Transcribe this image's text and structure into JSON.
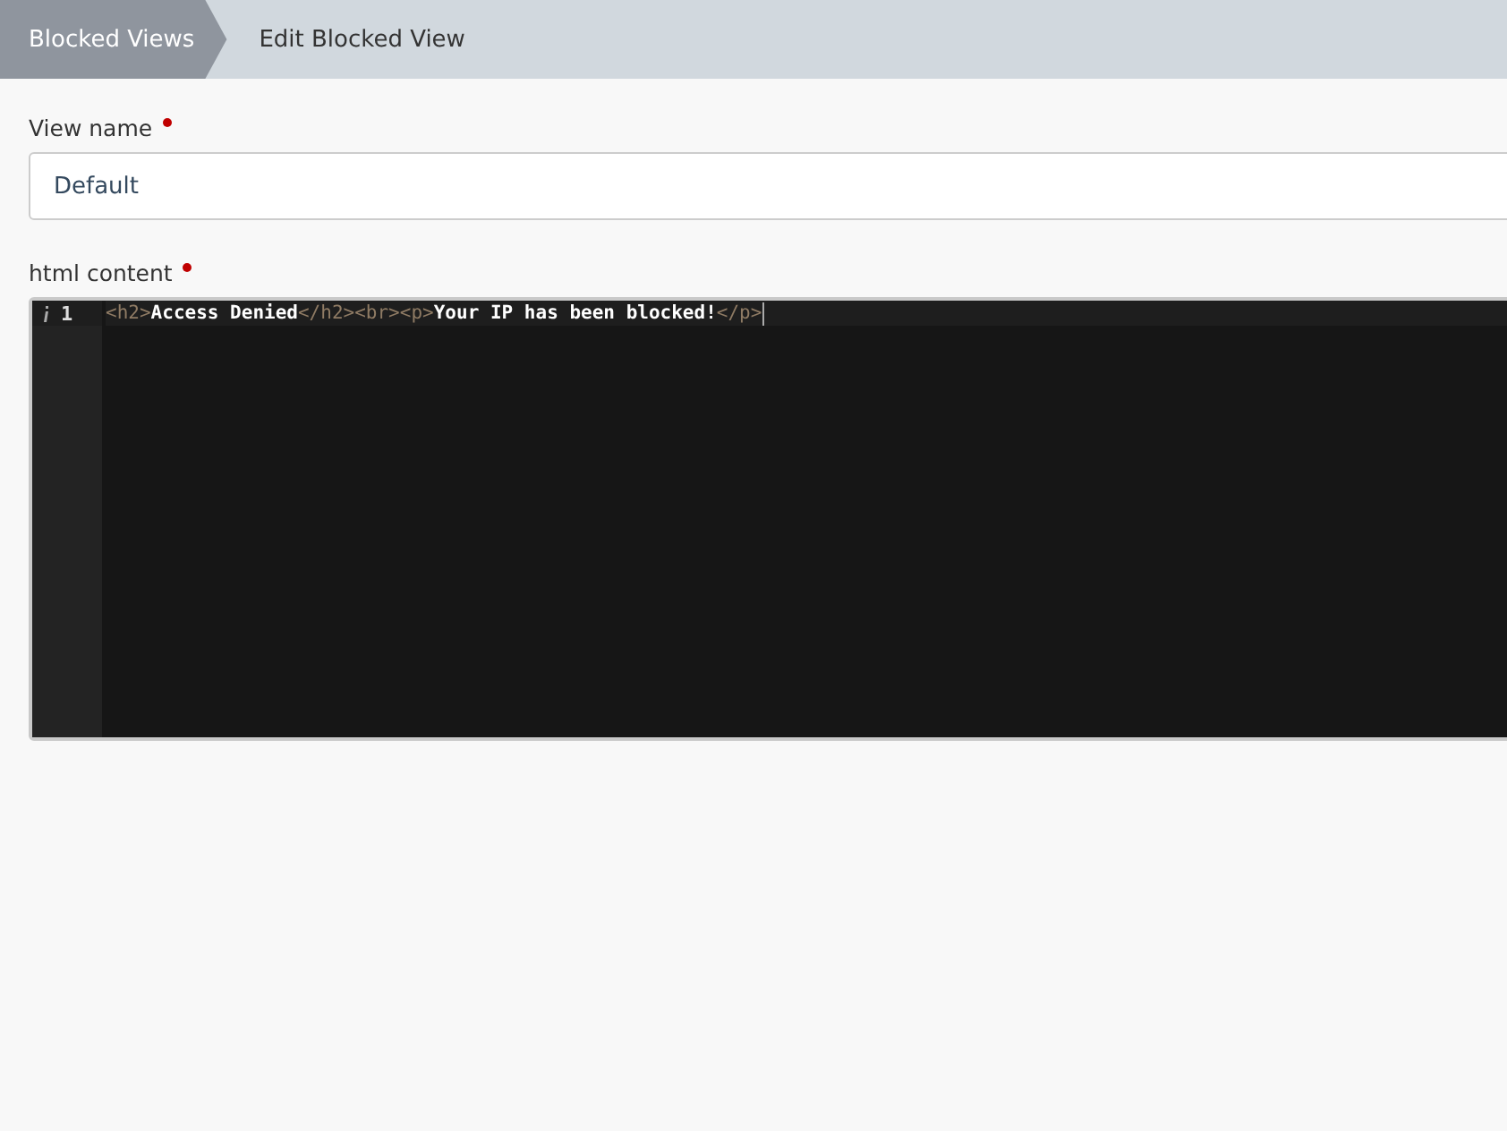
{
  "breadcrumbs": [
    {
      "label": "Blocked Views",
      "selected": true
    },
    {
      "label": "Edit Blocked View",
      "selected": false
    }
  ],
  "fields": [
    {
      "label": "View name",
      "required": true,
      "value": "Default"
    }
  ],
  "editor": {
    "label": "html content",
    "required": true,
    "lines": [
      {
        "number": "1",
        "tokens": [
          {
            "kind": "tag",
            "text": "<h2>"
          },
          {
            "kind": "text",
            "text": "Access Denied"
          },
          {
            "kind": "tag",
            "text": "</h2>"
          },
          {
            "kind": "tag",
            "text": "<br>"
          },
          {
            "kind": "tag",
            "text": "<p>"
          },
          {
            "kind": "text",
            "text": "Your IP has been blocked!"
          },
          {
            "kind": "tag",
            "text": "</p>"
          }
        ]
      }
    ]
  }
}
